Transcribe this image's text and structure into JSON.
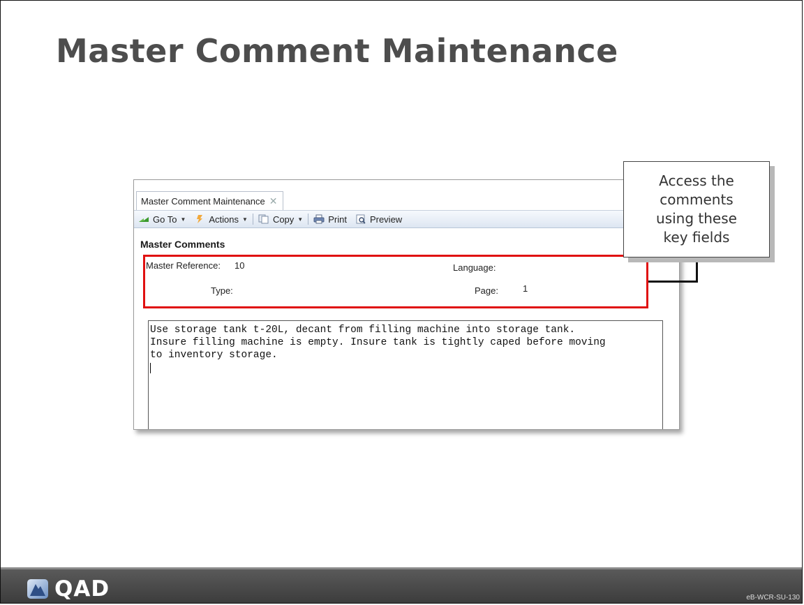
{
  "slide": {
    "title": "Master Comment Maintenance",
    "slide_code": "eB-WCR-SU-130"
  },
  "window": {
    "tab_label": "Master Comment Maintenance",
    "tab_close": "✕",
    "toolbar": {
      "goto_label": "Go To",
      "actions_label": "Actions",
      "copy_label": "Copy",
      "print_label": "Print",
      "preview_label": "Preview"
    },
    "section_title": "Master Comments",
    "fields": {
      "master_reference_label": "Master Reference:",
      "master_reference_value": "10",
      "language_label": "Language:",
      "language_value": "",
      "type_label": "Type:",
      "type_value": "",
      "page_label": "Page:",
      "page_value": "1"
    },
    "comment_lines": [
      "Use storage tank t-20L, decant from filling machine into storage tank.",
      "Insure filling machine is empty. Insure tank is tightly caped before moving",
      "to inventory storage."
    ]
  },
  "callout": {
    "lines": [
      "Access the",
      "comments",
      "using these",
      "key fields"
    ]
  },
  "footer": {
    "brand": "QAD"
  },
  "colors": {
    "highlight": "#e01010",
    "title": "#4d4d4d",
    "footer": "#4a4a4a"
  },
  "icons": [
    "goto-arrow-icon",
    "actions-flag-icon",
    "copy-icon",
    "print-icon",
    "preview-icon",
    "close-icon",
    "qad-logo-icon"
  ]
}
